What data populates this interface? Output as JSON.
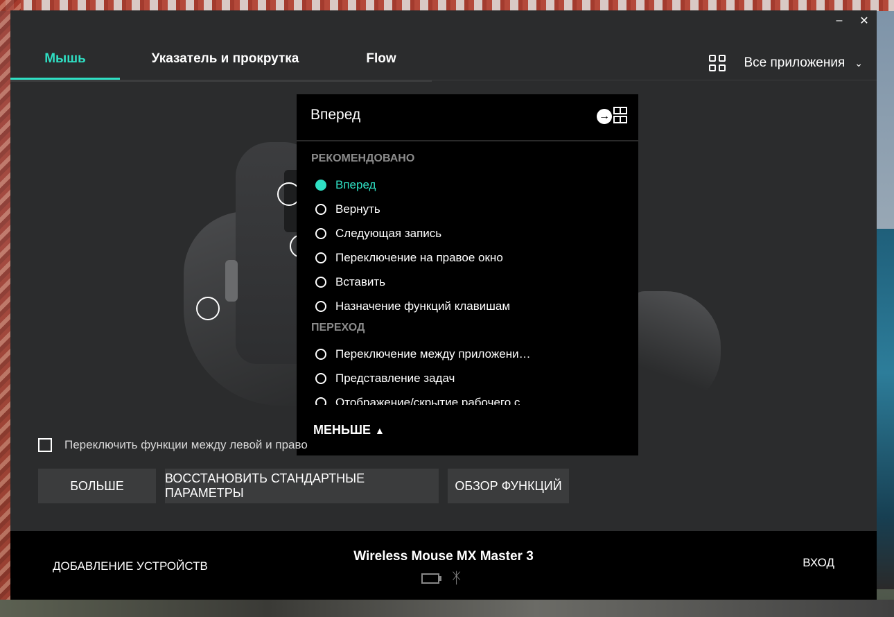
{
  "window": {
    "minimize_glyph": "–",
    "close_glyph": "✕"
  },
  "tabs": [
    {
      "label": "Мышь",
      "active": true
    },
    {
      "label": "Указатель и прокрутка",
      "active": false
    },
    {
      "label": "Flow",
      "active": false
    }
  ],
  "app_selector": {
    "label": "Все приложения",
    "icon": "apps-grid-icon"
  },
  "popup": {
    "title": "Вперед",
    "sections": [
      {
        "label": "РЕКОМЕНДОВАНО",
        "options": [
          {
            "label": "Вперед",
            "selected": true
          },
          {
            "label": "Вернуть",
            "selected": false
          },
          {
            "label": "Следующая запись",
            "selected": false
          },
          {
            "label": "Переключение на правое окно",
            "selected": false
          },
          {
            "label": "Вставить",
            "selected": false
          },
          {
            "label": "Назначение функций клавишам",
            "selected": false
          }
        ]
      },
      {
        "label": "ПЕРЕХОД",
        "options": [
          {
            "label": "Переключение между приложени…",
            "selected": false
          },
          {
            "label": "Представление задач",
            "selected": false
          },
          {
            "label": "Отображение/скрытие рабочего с",
            "selected": false
          }
        ]
      }
    ],
    "less_label": "МЕНЬШЕ"
  },
  "swap_checkbox": {
    "label": "Переключить функции между левой и право",
    "checked": false
  },
  "buttons": {
    "more": "БОЛЬШЕ",
    "restore": "ВОССТАНОВИТЬ СТАНДАРТНЫЕ ПАРАМЕТРЫ",
    "overview": "ОБЗОР ФУНКЦИЙ"
  },
  "footer": {
    "add_devices": "ДОБАВЛЕНИЕ УСТРОЙСТВ",
    "device_name": "Wireless Mouse MX Master 3",
    "login": "ВХОД"
  },
  "colors": {
    "accent": "#2fe0c4",
    "app_bg": "#2b2c2d",
    "popup_bg": "#000000"
  }
}
